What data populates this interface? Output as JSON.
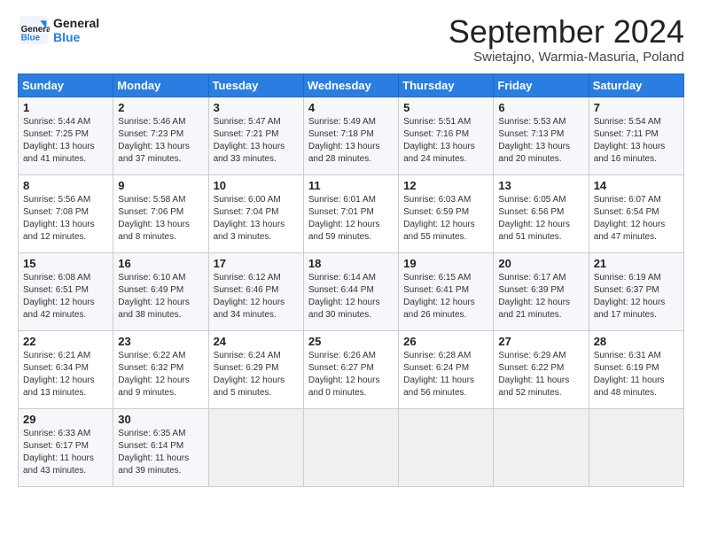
{
  "logo": {
    "line1": "General",
    "line2": "Blue"
  },
  "title": "September 2024",
  "subtitle": "Swietajno, Warmia-Masuria, Poland",
  "days_header": [
    "Sunday",
    "Monday",
    "Tuesday",
    "Wednesday",
    "Thursday",
    "Friday",
    "Saturday"
  ],
  "weeks": [
    [
      {
        "num": "1",
        "info": "Sunrise: 5:44 AM\nSunset: 7:25 PM\nDaylight: 13 hours\nand 41 minutes."
      },
      {
        "num": "2",
        "info": "Sunrise: 5:46 AM\nSunset: 7:23 PM\nDaylight: 13 hours\nand 37 minutes."
      },
      {
        "num": "3",
        "info": "Sunrise: 5:47 AM\nSunset: 7:21 PM\nDaylight: 13 hours\nand 33 minutes."
      },
      {
        "num": "4",
        "info": "Sunrise: 5:49 AM\nSunset: 7:18 PM\nDaylight: 13 hours\nand 28 minutes."
      },
      {
        "num": "5",
        "info": "Sunrise: 5:51 AM\nSunset: 7:16 PM\nDaylight: 13 hours\nand 24 minutes."
      },
      {
        "num": "6",
        "info": "Sunrise: 5:53 AM\nSunset: 7:13 PM\nDaylight: 13 hours\nand 20 minutes."
      },
      {
        "num": "7",
        "info": "Sunrise: 5:54 AM\nSunset: 7:11 PM\nDaylight: 13 hours\nand 16 minutes."
      }
    ],
    [
      {
        "num": "8",
        "info": "Sunrise: 5:56 AM\nSunset: 7:08 PM\nDaylight: 13 hours\nand 12 minutes."
      },
      {
        "num": "9",
        "info": "Sunrise: 5:58 AM\nSunset: 7:06 PM\nDaylight: 13 hours\nand 8 minutes."
      },
      {
        "num": "10",
        "info": "Sunrise: 6:00 AM\nSunset: 7:04 PM\nDaylight: 13 hours\nand 3 minutes."
      },
      {
        "num": "11",
        "info": "Sunrise: 6:01 AM\nSunset: 7:01 PM\nDaylight: 12 hours\nand 59 minutes."
      },
      {
        "num": "12",
        "info": "Sunrise: 6:03 AM\nSunset: 6:59 PM\nDaylight: 12 hours\nand 55 minutes."
      },
      {
        "num": "13",
        "info": "Sunrise: 6:05 AM\nSunset: 6:56 PM\nDaylight: 12 hours\nand 51 minutes."
      },
      {
        "num": "14",
        "info": "Sunrise: 6:07 AM\nSunset: 6:54 PM\nDaylight: 12 hours\nand 47 minutes."
      }
    ],
    [
      {
        "num": "15",
        "info": "Sunrise: 6:08 AM\nSunset: 6:51 PM\nDaylight: 12 hours\nand 42 minutes."
      },
      {
        "num": "16",
        "info": "Sunrise: 6:10 AM\nSunset: 6:49 PM\nDaylight: 12 hours\nand 38 minutes."
      },
      {
        "num": "17",
        "info": "Sunrise: 6:12 AM\nSunset: 6:46 PM\nDaylight: 12 hours\nand 34 minutes."
      },
      {
        "num": "18",
        "info": "Sunrise: 6:14 AM\nSunset: 6:44 PM\nDaylight: 12 hours\nand 30 minutes."
      },
      {
        "num": "19",
        "info": "Sunrise: 6:15 AM\nSunset: 6:41 PM\nDaylight: 12 hours\nand 26 minutes."
      },
      {
        "num": "20",
        "info": "Sunrise: 6:17 AM\nSunset: 6:39 PM\nDaylight: 12 hours\nand 21 minutes."
      },
      {
        "num": "21",
        "info": "Sunrise: 6:19 AM\nSunset: 6:37 PM\nDaylight: 12 hours\nand 17 minutes."
      }
    ],
    [
      {
        "num": "22",
        "info": "Sunrise: 6:21 AM\nSunset: 6:34 PM\nDaylight: 12 hours\nand 13 minutes."
      },
      {
        "num": "23",
        "info": "Sunrise: 6:22 AM\nSunset: 6:32 PM\nDaylight: 12 hours\nand 9 minutes."
      },
      {
        "num": "24",
        "info": "Sunrise: 6:24 AM\nSunset: 6:29 PM\nDaylight: 12 hours\nand 5 minutes."
      },
      {
        "num": "25",
        "info": "Sunrise: 6:26 AM\nSunset: 6:27 PM\nDaylight: 12 hours\nand 0 minutes."
      },
      {
        "num": "26",
        "info": "Sunrise: 6:28 AM\nSunset: 6:24 PM\nDaylight: 11 hours\nand 56 minutes."
      },
      {
        "num": "27",
        "info": "Sunrise: 6:29 AM\nSunset: 6:22 PM\nDaylight: 11 hours\nand 52 minutes."
      },
      {
        "num": "28",
        "info": "Sunrise: 6:31 AM\nSunset: 6:19 PM\nDaylight: 11 hours\nand 48 minutes."
      }
    ],
    [
      {
        "num": "29",
        "info": "Sunrise: 6:33 AM\nSunset: 6:17 PM\nDaylight: 11 hours\nand 43 minutes."
      },
      {
        "num": "30",
        "info": "Sunrise: 6:35 AM\nSunset: 6:14 PM\nDaylight: 11 hours\nand 39 minutes."
      },
      {
        "num": "",
        "info": ""
      },
      {
        "num": "",
        "info": ""
      },
      {
        "num": "",
        "info": ""
      },
      {
        "num": "",
        "info": ""
      },
      {
        "num": "",
        "info": ""
      }
    ]
  ]
}
